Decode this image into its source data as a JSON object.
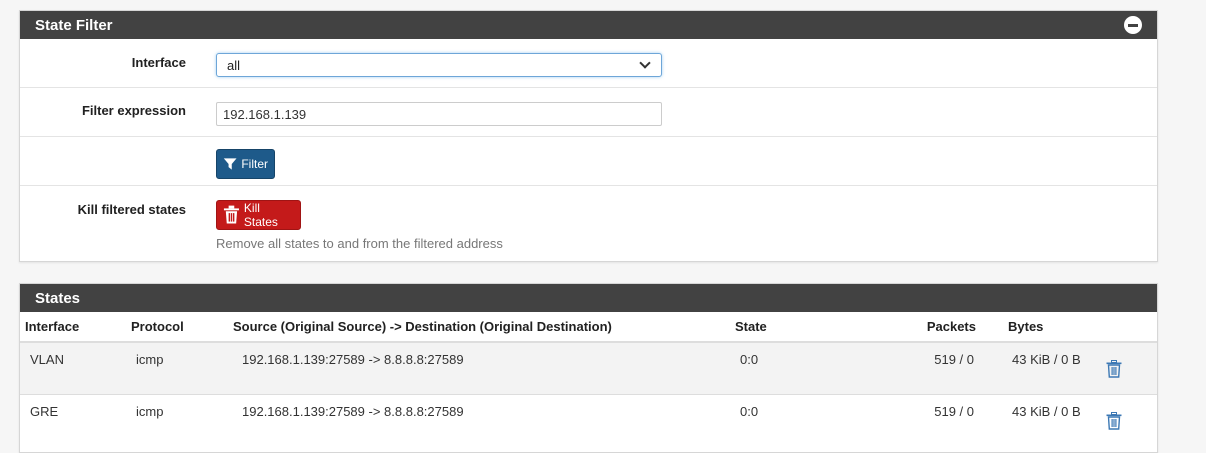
{
  "filter_panel": {
    "title": "State Filter",
    "interface_label": "Interface",
    "interface_value": "all",
    "expression_label": "Filter expression",
    "expression_value": "192.168.1.139",
    "filter_button": "Filter",
    "kill_label": "Kill filtered states",
    "kill_button": "Kill States",
    "kill_help": "Remove all states to and from the filtered address"
  },
  "states_panel": {
    "title": "States",
    "columns": [
      "Interface",
      "Protocol",
      "Source (Original Source) -> Destination (Original Destination)",
      "State",
      "Packets",
      "Bytes"
    ],
    "rows": [
      {
        "interface": "VLAN",
        "protocol": "icmp",
        "route": "192.168.1.139:27589 -> 8.8.8.8:27589",
        "state": "0:0",
        "packets": "519 / 0",
        "bytes": "43 KiB / 0 B"
      },
      {
        "interface": "GRE",
        "protocol": "icmp",
        "route": "192.168.1.139:27589 -> 8.8.8.8:27589",
        "state": "0:0",
        "packets": "519 / 0",
        "bytes": "43 KiB / 0 B"
      }
    ]
  },
  "colors": {
    "header": "#424242",
    "primary": "#1e5a8a",
    "danger": "#c41a1a",
    "trash": "#3c78b4"
  }
}
